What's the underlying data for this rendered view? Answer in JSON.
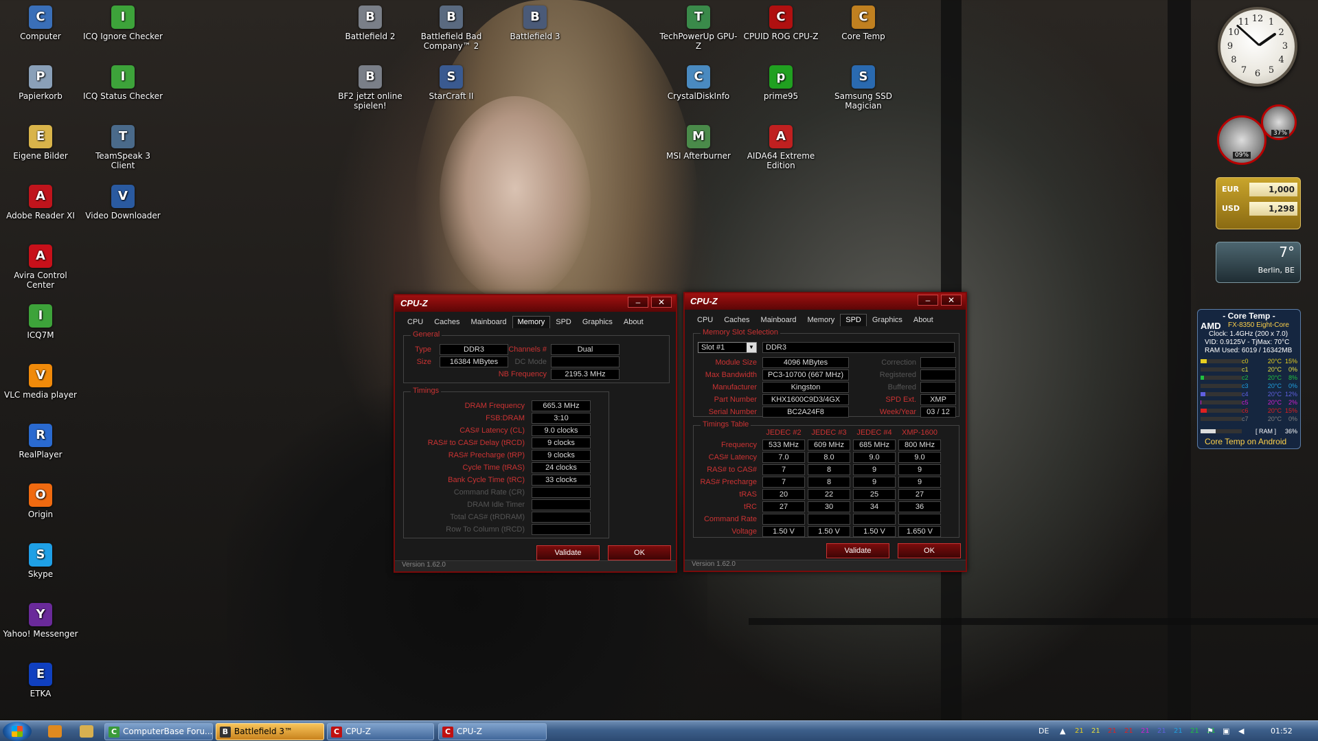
{
  "desktop_icons_left": [
    {
      "label": "Computer",
      "icon": "computer-icon",
      "color": "#3a6fb8"
    },
    {
      "label": "Papierkorb",
      "icon": "recycle-bin-icon",
      "color": "#8aa0b8"
    },
    {
      "label": "Eigene Bilder",
      "icon": "pictures-folder-icon",
      "color": "#d9b44a"
    },
    {
      "label": "Adobe Reader XI",
      "icon": "adobe-reader-icon",
      "color": "#c0141c"
    },
    {
      "label": "Avira Control Center",
      "icon": "avira-icon",
      "color": "#c8101a"
    },
    {
      "label": "ICQ7M",
      "icon": "icq-icon",
      "color": "#3da33a"
    },
    {
      "label": "VLC media player",
      "icon": "vlc-icon",
      "color": "#f08a0a"
    },
    {
      "label": "RealPlayer",
      "icon": "realplayer-icon",
      "color": "#2a6ad0"
    },
    {
      "label": "Origin",
      "icon": "origin-icon",
      "color": "#f06a10"
    },
    {
      "label": "Skype",
      "icon": "skype-icon",
      "color": "#1fa0e6"
    },
    {
      "label": "Yahoo! Messenger",
      "icon": "yahoo-messenger-icon",
      "color": "#6a2a9a"
    },
    {
      "label": "ETKA",
      "icon": "etka-icon",
      "color": "#1040c0"
    }
  ],
  "desktop_icons_col2": [
    {
      "label": "ICQ Ignore Checker",
      "icon": "icq-ignore-checker-icon",
      "color": "#3da33a"
    },
    {
      "label": "ICQ Status Checker",
      "icon": "icq-status-checker-icon",
      "color": "#3da33a"
    },
    {
      "label": "TeamSpeak 3 Client",
      "icon": "teamspeak-icon",
      "color": "#4a6a8a"
    },
    {
      "label": "Video Downloader",
      "icon": "video-downloader-icon",
      "color": "#2a5aa0"
    }
  ],
  "desktop_icons_top": [
    {
      "label": "Battlefield 2",
      "icon": "battlefield2-icon",
      "color": "#7a7f88"
    },
    {
      "label": "Battlefield Bad Company™ 2",
      "icon": "battlefield-bc2-icon",
      "color": "#5a6a80"
    },
    {
      "label": "Battlefield 3",
      "icon": "battlefield3-icon",
      "color": "#4a5a78"
    },
    {
      "label": "BF2 jetzt online spielen!",
      "icon": "bf2-online-icon",
      "color": "#7a7f88"
    },
    {
      "label": "StarCraft II",
      "icon": "starcraft-icon",
      "color": "#3a5a90"
    },
    {
      "label": "TechPowerUp GPU-Z",
      "icon": "gpuz-icon",
      "color": "#3a8a4a"
    },
    {
      "label": "CPUID ROG CPU-Z",
      "icon": "rog-cpuz-icon",
      "color": "#b01010"
    },
    {
      "label": "Core Temp",
      "icon": "core-temp-icon",
      "color": "#c08020"
    },
    {
      "label": "CrystalDiskInfo",
      "icon": "crystaldiskinfo-icon",
      "color": "#4a8ac0"
    },
    {
      "label": "prime95",
      "icon": "prime95-icon",
      "color": "#20a020"
    },
    {
      "label": "Samsung SSD Magician",
      "icon": "samsung-ssd-icon",
      "color": "#2a6ab0"
    },
    {
      "label": "MSI Afterburner",
      "icon": "msi-afterburner-icon",
      "color": "#4a8a4a"
    },
    {
      "label": "AIDA64 Extreme Edition",
      "icon": "aida64-icon",
      "color": "#c02020"
    }
  ],
  "cpuz_memory": {
    "title": "CPU-Z",
    "tabs": [
      "CPU",
      "Caches",
      "Mainboard",
      "Memory",
      "SPD",
      "Graphics",
      "About"
    ],
    "active_tab": "Memory",
    "general": {
      "legend": "General",
      "type_label": "Type",
      "type": "DDR3",
      "size_label": "Size",
      "size": "16384 MBytes",
      "channels_label": "Channels #",
      "channels": "Dual",
      "dcmode_label": "DC Mode",
      "dcmode": "",
      "nbfreq_label": "NB Frequency",
      "nbfreq": "2195.3 MHz"
    },
    "timings": {
      "legend": "Timings",
      "rows": [
        {
          "label": "DRAM Frequency",
          "value": "665.3 MHz",
          "dim": false
        },
        {
          "label": "FSB:DRAM",
          "value": "3:10",
          "dim": false
        },
        {
          "label": "CAS# Latency (CL)",
          "value": "9.0 clocks",
          "dim": false
        },
        {
          "label": "RAS# to CAS# Delay (tRCD)",
          "value": "9 clocks",
          "dim": false
        },
        {
          "label": "RAS# Precharge (tRP)",
          "value": "9 clocks",
          "dim": false
        },
        {
          "label": "Cycle Time (tRAS)",
          "value": "24 clocks",
          "dim": false
        },
        {
          "label": "Bank Cycle Time (tRC)",
          "value": "33 clocks",
          "dim": false
        },
        {
          "label": "Command Rate (CR)",
          "value": "",
          "dim": true
        },
        {
          "label": "DRAM Idle Timer",
          "value": "",
          "dim": true
        },
        {
          "label": "Total CAS# (tRDRAM)",
          "value": "",
          "dim": true
        },
        {
          "label": "Row To Column (tRCD)",
          "value": "",
          "dim": true
        }
      ]
    },
    "validate": "Validate",
    "ok": "OK",
    "version": "Version 1.62.0"
  },
  "cpuz_spd": {
    "title": "CPU-Z",
    "tabs": [
      "CPU",
      "Caches",
      "Mainboard",
      "Memory",
      "SPD",
      "Graphics",
      "About"
    ],
    "active_tab": "SPD",
    "slot_legend": "Memory Slot Selection",
    "slot": "Slot #1",
    "slot_type": "DDR3",
    "module_size_label": "Module Size",
    "module_size": "4096 MBytes",
    "max_bw_label": "Max Bandwidth",
    "max_bw": "PC3-10700 (667 MHz)",
    "manufacturer_label": "Manufacturer",
    "manufacturer": "Kingston",
    "part_label": "Part Number",
    "part": "KHX1600C9D3/4GX",
    "serial_label": "Serial Number",
    "serial": "BC2A24F8",
    "correction_label": "Correction",
    "correction": "",
    "registered_label": "Registered",
    "registered": "",
    "buffered_label": "Buffered",
    "buffered": "",
    "spdext_label": "SPD Ext.",
    "spdext": "XMP",
    "weekyear_label": "Week/Year",
    "weekyear": "03 / 12",
    "timings_legend": "Timings Table",
    "columns": [
      "JEDEC #2",
      "JEDEC #3",
      "JEDEC #4",
      "XMP-1600"
    ],
    "rows": [
      {
        "label": "Frequency",
        "values": [
          "533 MHz",
          "609 MHz",
          "685 MHz",
          "800 MHz"
        ]
      },
      {
        "label": "CAS# Latency",
        "values": [
          "7.0",
          "8.0",
          "9.0",
          "9.0"
        ]
      },
      {
        "label": "RAS# to CAS#",
        "values": [
          "7",
          "8",
          "9",
          "9"
        ]
      },
      {
        "label": "RAS# Precharge",
        "values": [
          "7",
          "8",
          "9",
          "9"
        ]
      },
      {
        "label": "tRAS",
        "values": [
          "20",
          "22",
          "25",
          "27"
        ]
      },
      {
        "label": "tRC",
        "values": [
          "27",
          "30",
          "34",
          "36"
        ]
      },
      {
        "label": "Command Rate",
        "values": [
          "",
          "",
          "",
          ""
        ]
      },
      {
        "label": "Voltage",
        "values": [
          "1.50 V",
          "1.50 V",
          "1.50 V",
          "1.650 V"
        ]
      }
    ],
    "validate": "Validate",
    "ok": "OK",
    "version": "Version 1.62.0"
  },
  "gadgets": {
    "clock_numbers": [
      "12",
      "1",
      "2",
      "3",
      "4",
      "5",
      "6",
      "7",
      "8",
      "9",
      "10",
      "11"
    ],
    "meter_cpu": "09%",
    "meter_ram": "37%",
    "currency": [
      {
        "code": "EUR",
        "amount": "1,000"
      },
      {
        "code": "USD",
        "amount": "1,298"
      }
    ],
    "weather_temp": "7°",
    "weather_city": "Berlin, BE",
    "coretemp": {
      "title": "- Core Temp -",
      "brand": "AMD",
      "cpu": "FX-8350 Eight-Core",
      "clock": "Clock: 1.4GHz (200 x 7.0)",
      "vid": "VID: 0.9125V - TjMax: 70°C",
      "ram": "RAM Used: 6019 / 16342MB",
      "cores": [
        {
          "name": "c0",
          "temp": "20°C",
          "pct": "15%",
          "load": 15,
          "color": "#e8d020"
        },
        {
          "name": "c1",
          "temp": "20°C",
          "pct": "0%",
          "load": 0,
          "color": "#e8e040"
        },
        {
          "name": "c2",
          "temp": "20°C",
          "pct": "8%",
          "load": 8,
          "color": "#20c040"
        },
        {
          "name": "c3",
          "temp": "20°C",
          "pct": "0%",
          "load": 0,
          "color": "#20a0e0"
        },
        {
          "name": "c4",
          "temp": "20°C",
          "pct": "12%",
          "load": 12,
          "color": "#6060e0"
        },
        {
          "name": "c5",
          "temp": "20°C",
          "pct": "2%",
          "load": 2,
          "color": "#d020d0"
        },
        {
          "name": "c6",
          "temp": "20°C",
          "pct": "15%",
          "load": 15,
          "color": "#e02020"
        },
        {
          "name": "c7",
          "temp": "20°C",
          "pct": "0%",
          "load": 0,
          "color": "#808080"
        }
      ],
      "ram_label": "[ RAM ]",
      "ram_pct": "36%",
      "ram_load": 36,
      "android": "Core Temp on Android"
    }
  },
  "taskbar": {
    "buttons": [
      {
        "label": "ComputerBase Foru...",
        "icon": "chrome-icon",
        "color": "#3a9a3a",
        "active": false
      },
      {
        "label": "Battlefield 3™",
        "icon": "battlefield3-icon",
        "color": "#333",
        "active": true
      },
      {
        "label": "CPU-Z",
        "icon": "cpuz-icon",
        "color": "#c01010",
        "active": false
      },
      {
        "label": "CPU-Z",
        "icon": "cpuz-icon",
        "color": "#c01010",
        "active": false
      }
    ],
    "lang": "DE",
    "temps": [
      {
        "v": "21",
        "color": "#e8d020"
      },
      {
        "v": "21",
        "color": "#e8e040"
      },
      {
        "v": "21",
        "color": "#e02020"
      },
      {
        "v": "21",
        "color": "#e02020"
      },
      {
        "v": "21",
        "color": "#d020d0"
      },
      {
        "v": "21",
        "color": "#6060e0"
      },
      {
        "v": "21",
        "color": "#20a0e0"
      },
      {
        "v": "21",
        "color": "#20c040"
      },
      {
        "v": "21",
        "color": "#20c040"
      }
    ],
    "time": "01:52"
  }
}
